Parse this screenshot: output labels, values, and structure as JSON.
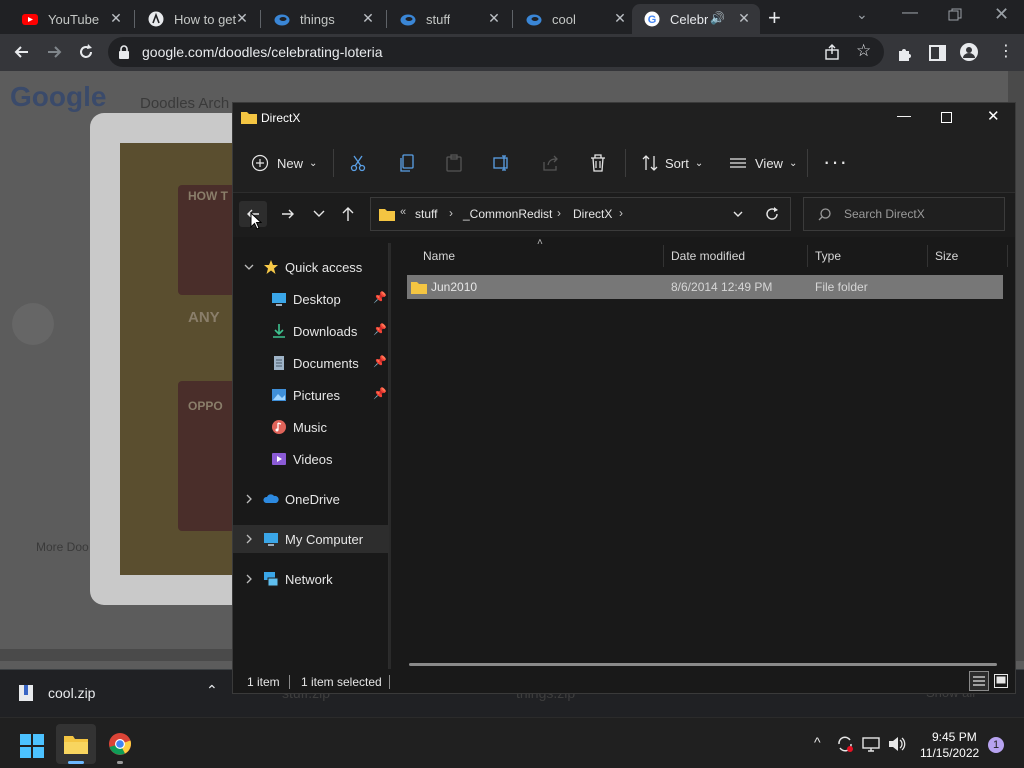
{
  "browser": {
    "tabs": [
      {
        "label": "YouTube",
        "icon": "youtube-icon"
      },
      {
        "label": "How to get",
        "icon": "site-icon"
      },
      {
        "label": "things",
        "icon": "edge-icon"
      },
      {
        "label": "stuff",
        "icon": "edge-icon"
      },
      {
        "label": "cool",
        "icon": "edge-icon"
      },
      {
        "label": "Celebra",
        "icon": "google-icon",
        "active": true
      }
    ],
    "url": "google.com/doodles/celebrating-loteria"
  },
  "page": {
    "logo": "Google",
    "nav_text": "Doodles Arch",
    "more_text": "More Doo",
    "doodle_text_1": "HOW T",
    "doodle_text_2": "ANY",
    "doodle_text_3": "OPPO"
  },
  "downloads": {
    "item1": "cool.zip",
    "item2": "stuff.zip",
    "item3": "things.zip",
    "show_all": "Show all"
  },
  "explorer": {
    "title": "DirectX",
    "toolbar": {
      "new_label": "New",
      "sort_label": "Sort",
      "view_label": "View"
    },
    "breadcrumb": [
      "stuff",
      "_CommonRedist",
      "DirectX"
    ],
    "search_placeholder": "Search DirectX",
    "nav": {
      "quick_access": "Quick access",
      "desktop": "Desktop",
      "downloads": "Downloads",
      "documents": "Documents",
      "pictures": "Pictures",
      "music": "Music",
      "videos": "Videos",
      "onedrive": "OneDrive",
      "my_computer": "My Computer",
      "network": "Network"
    },
    "columns": {
      "name": "Name",
      "date": "Date modified",
      "type": "Type",
      "size": "Size"
    },
    "rows": [
      {
        "name": "Jun2010",
        "date": "8/6/2014 12:49 PM",
        "type": "File folder",
        "size": ""
      }
    ],
    "status": {
      "count": "1 item",
      "selected": "1 item selected"
    }
  },
  "taskbar": {
    "time": "9:45 PM",
    "date": "11/15/2022",
    "notification_count": "1"
  }
}
